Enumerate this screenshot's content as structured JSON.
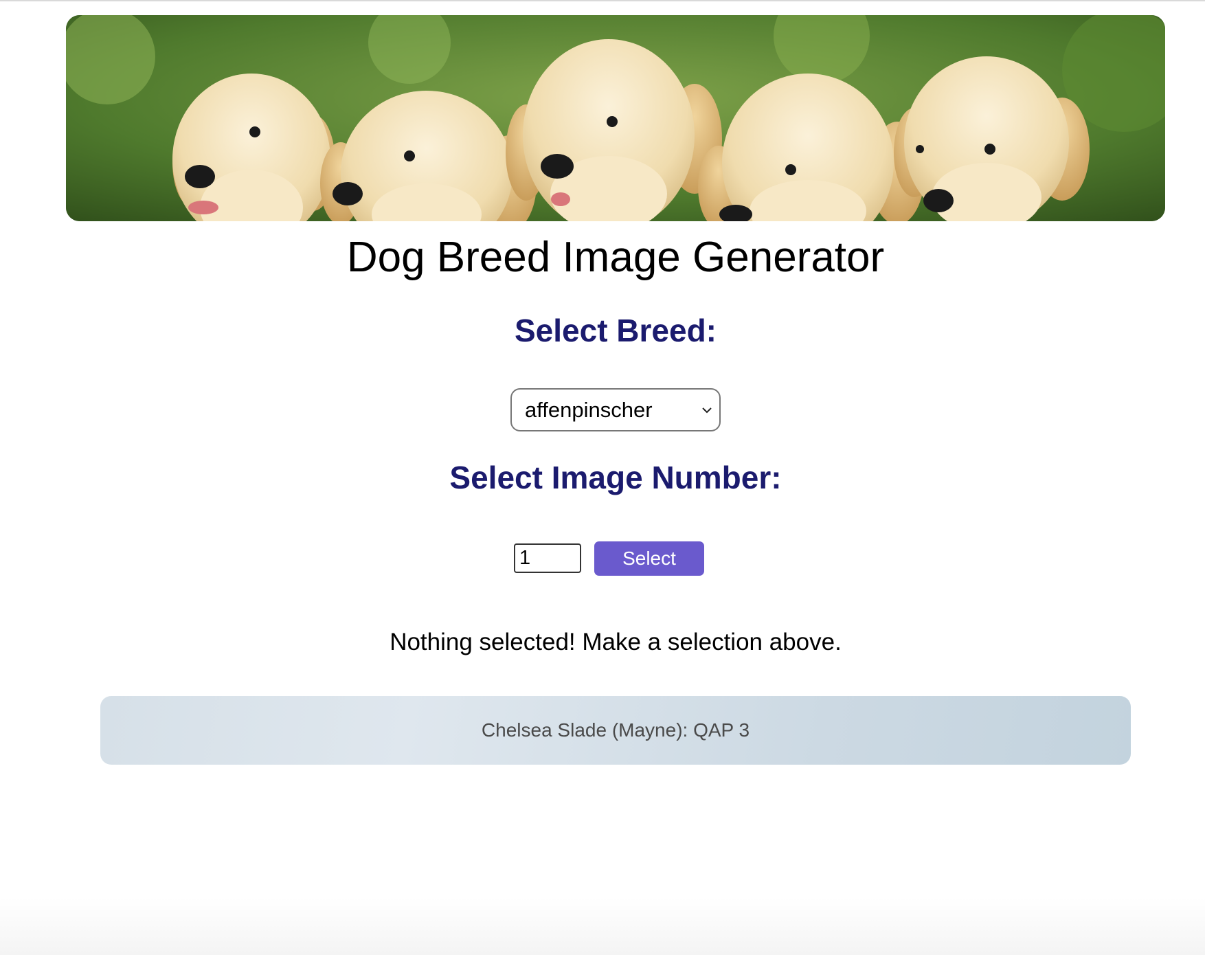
{
  "banner": {
    "alt": "Five golden retriever puppies"
  },
  "title": "Dog Breed Image Generator",
  "breed_section": {
    "heading": "Select Breed:",
    "selected_value": "affenpinscher"
  },
  "number_section": {
    "heading": "Select Image Number:",
    "input_value": "1",
    "button_label": "Select"
  },
  "status_message": "Nothing selected! Make a selection above.",
  "footer": {
    "text": "Chelsea Slade (Mayne): QAP 3"
  },
  "colors": {
    "heading": "#1b1b6e",
    "button": "#6a5acd",
    "footer_bg": "#d6e0e8"
  }
}
